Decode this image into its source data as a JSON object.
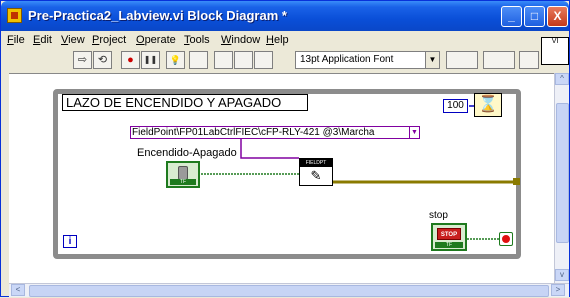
{
  "window": {
    "title": "Pre-Practica2_Labview.vi Block Diagram *",
    "buttons": {
      "minimize": "_",
      "maximize": "□",
      "close": "X"
    }
  },
  "menu": [
    "File",
    "Edit",
    "View",
    "Project",
    "Operate",
    "Tools",
    "Window",
    "Help"
  ],
  "toolbar": {
    "run_icon": "⇨",
    "run_continuous_icon": "⟲",
    "abort_icon": "●",
    "pause_icon": "❚❚",
    "highlight_icon": "💡",
    "font_select": "13pt Application Font",
    "font_arrow": "▼"
  },
  "vi_icon": "VI",
  "diagram": {
    "loop_label": "LAZO DE ENCENDIDO Y APAGADO",
    "wait_constant": "100",
    "wait_icon": "⌛",
    "fieldpoint_path": "FieldPoint\\FP01LabCtrlFIEC\\cFP-RLY-421 @3\\Marcha",
    "fieldpoint_arrow": "▼",
    "control_label": "Encendido-Apagado",
    "bool_tf": "TF",
    "fp_write_header": "FIELDPT",
    "fp_write_icon": "✎",
    "stop_label": "stop",
    "stop_button_text": "STOP",
    "stop_tf": "TF",
    "iteration_terminal": "i"
  },
  "scroll": {
    "left": "<",
    "right": ">",
    "up": "^",
    "down": "v"
  },
  "colors": {
    "title_bar": "#0a4fd8",
    "bool_wire": "#1e7a1e",
    "fieldpoint_wire": "#8000a0",
    "loop_border": "#8c8c8c"
  }
}
